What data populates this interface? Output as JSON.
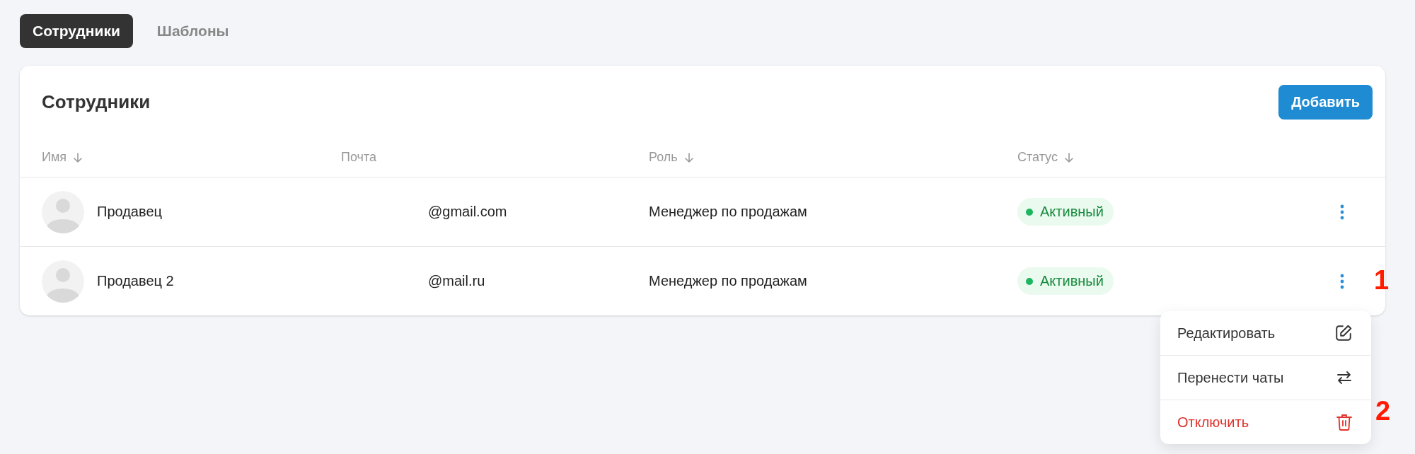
{
  "tabs": [
    {
      "label": "Сотрудники",
      "selected": true
    },
    {
      "label": "Шаблоны",
      "selected": false
    }
  ],
  "panel": {
    "title": "Сотрудники",
    "add_button": "Добавить"
  },
  "table": {
    "columns": [
      {
        "label": "Имя",
        "sortable": true
      },
      {
        "label": "Почта",
        "sortable": false
      },
      {
        "label": "Роль",
        "sortable": true
      },
      {
        "label": "Статус",
        "sortable": true
      }
    ],
    "rows": [
      {
        "name": "Продавец",
        "email": "@gmail.com",
        "role": "Менеджер по продажам",
        "status": "Активный"
      },
      {
        "name": "Продавец 2",
        "email": "@mail.ru",
        "role": "Менеджер по продажам",
        "status": "Активный"
      }
    ]
  },
  "row_menu": {
    "items": [
      {
        "kind": "edit",
        "label": "Редактировать"
      },
      {
        "kind": "transfer",
        "label": "Перенести чаты"
      },
      {
        "kind": "delete",
        "label": "Отключить"
      }
    ]
  },
  "annotations": [
    {
      "label": "1"
    },
    {
      "label": "2"
    }
  ]
}
